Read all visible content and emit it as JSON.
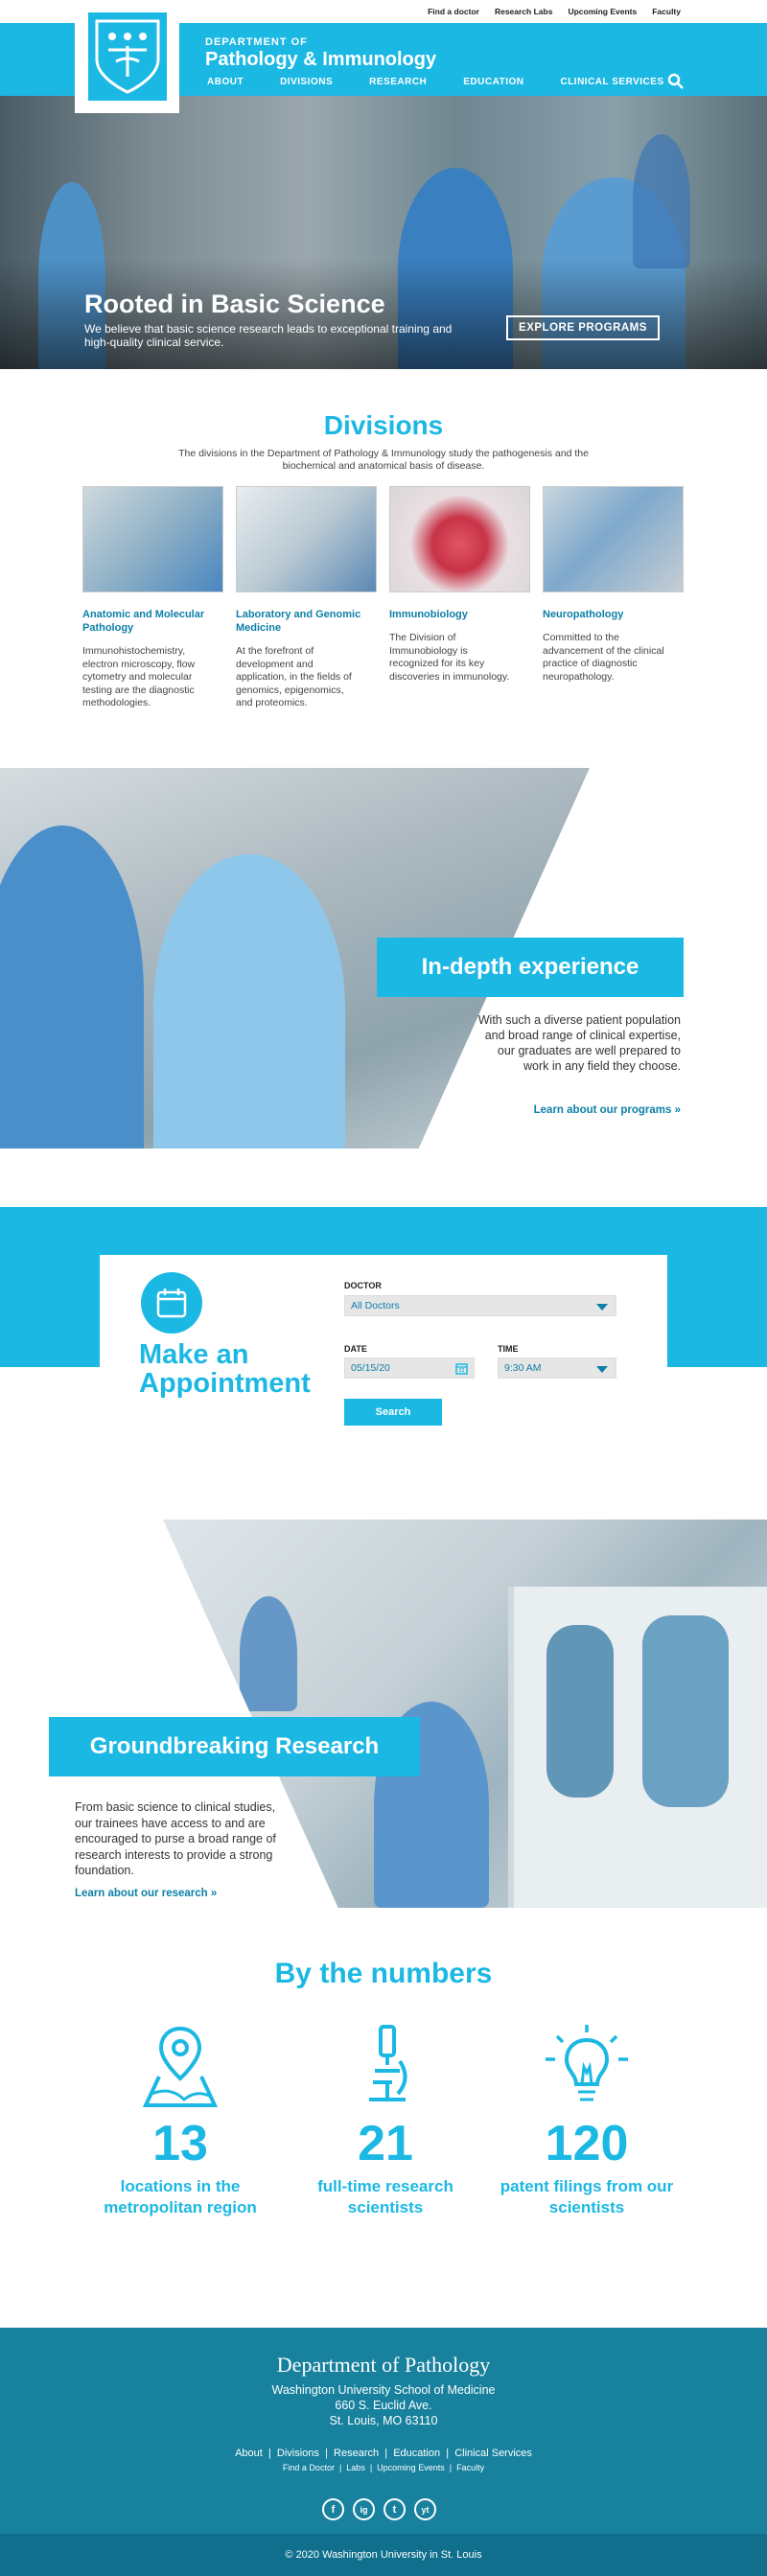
{
  "colors": {
    "brand": "#1cb8e4",
    "dark_teal": "#17819e",
    "link": "#0d7fa8"
  },
  "utility_nav": [
    "Find a doctor",
    "Research Labs",
    "Upcoming Events",
    "Faculty"
  ],
  "header": {
    "dept_small": "DEPARTMENT OF",
    "dept_large": "Pathology & Immunology",
    "logo_icon": "university-shield-icon"
  },
  "main_nav": [
    "ABOUT",
    "DIVISIONS",
    "RESEARCH",
    "EDUCATION",
    "CLINICAL SERVICES"
  ],
  "hero": {
    "title": "Rooted in Basic Science",
    "subtitle": "We believe that basic science research leads to exceptional training and high-quality clinical service.",
    "button": "EXPLORE PROGRAMS"
  },
  "divisions": {
    "title": "Divisions",
    "intro": "The divisions in the Department of Pathology & Immunology study the pathogenesis and the biochemical and anatomical basis of disease.",
    "cards": [
      {
        "title": "Anatomic and Molecular Pathology",
        "text": "Immunohistochemistry, electron microscopy, flow cytometry and molecular testing are the diagnostic methodologies."
      },
      {
        "title": "Laboratory and Genomic Medicine",
        "text": "At the forefront of development and application, in the fields of genomics, epigenomics, and proteomics."
      },
      {
        "title": "Immunobiology",
        "text": "The Division of Immunobiology is recognized for its key discoveries in immunology."
      },
      {
        "title": "Neuropathology",
        "text": "Committed to the advancement of the clinical practice of diagnostic neuropathology."
      }
    ]
  },
  "indepth": {
    "title": "In-depth experience",
    "text": "With such a diverse patient population and broad range of clinical expertise, our graduates are well prepared to work in any field they choose.",
    "link": "Learn about our programs »"
  },
  "appointment": {
    "title_line1": "Make an",
    "title_line2": "Appointment",
    "doctor_label": "DOCTOR",
    "doctor_value": "All Doctors",
    "date_label": "DATE",
    "date_value": "05/15/20",
    "time_label": "TIME",
    "time_value": "9:30 AM",
    "button": "Search"
  },
  "research": {
    "title": "Groundbreaking Research",
    "text": "From basic science to clinical studies, our trainees have access to and are encouraged to purse a broad range of research interests to provide a strong foundation.",
    "link": "Learn about our research »"
  },
  "numbers": {
    "title": "By the numbers",
    "stats": [
      {
        "icon": "map-pin-icon",
        "value": "13",
        "label": "locations in the metropolitan region"
      },
      {
        "icon": "microscope-icon",
        "value": "21",
        "label": "full-time research scientists"
      },
      {
        "icon": "lightbulb-icon",
        "value": "120",
        "label": "patent filings from our scientists"
      }
    ]
  },
  "footer": {
    "dept": "Department of Pathology",
    "school": "Washington University School of Medicine",
    "street": "660 S. Euclid Ave.",
    "city": "St. Louis, MO 63110",
    "links1": [
      "About",
      "Divisions",
      "Research",
      "Education",
      "Clinical Services"
    ],
    "links2": [
      "Find a Doctor",
      "Labs",
      "Upcoming Events",
      "Faculty"
    ],
    "social": [
      "f",
      "ig",
      "t",
      "yt"
    ],
    "copyright": "© 2020 Washington University in St. Louis"
  }
}
